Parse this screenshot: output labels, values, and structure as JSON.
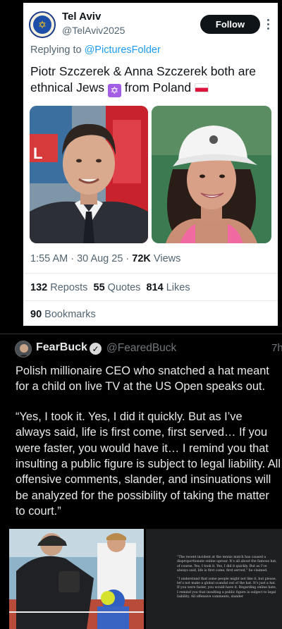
{
  "tweet1": {
    "avatar_icon": "menorah-logo-icon",
    "name": "Tel Aviv",
    "handle": "@TelAviv2025",
    "follow_label": "Follow",
    "reply_prefix": "Replying to",
    "reply_to": "@PicturesFolder",
    "text_before_star": "Piotr Szczerek & Anna Szczerek both are ethnical Jews ",
    "text_after_star": " from Poland ",
    "time": "1:55 AM · 30 Aug 25 · ",
    "views_count": "72K",
    "views_label": " Views",
    "reposts_count": "132",
    "reposts_label": " Reposts",
    "quotes_count": "55",
    "quotes_label": " Quotes",
    "likes_count": "814",
    "likes_label": " Likes",
    "bookmarks_count": "90",
    "bookmarks_label": " Bookmarks"
  },
  "tweet2": {
    "name": "FearBuck",
    "handle": "@FearedBuck",
    "time": "7h",
    "paragraph1": "Polish millionaire CEO who snatched a hat meant for a child on live TV at the US Open speaks out.",
    "paragraph2": "“Yes, I took it. Yes, I did it quickly. But as I’ve always said, life is first come, first served… If you were faster, you would have it… I remind you that insulting a public figure is subject to legal liability. All offensive comments, slander, and insinuations will be analyzed for the possibility of taking the matter to court.”",
    "article_p1": "“The recent incident at the tennis match has caused a disproportionate online uproar. It’s all about the famous hat, of course. Yes, I took it. Yes, I did it quickly. But as I’ve always said, life is first come, first served,” he claimed.",
    "article_p2": "“I understand that some people might not like it, but please, let’s not make a global scandal out of the hat. It’s just a hat. If you were faster, you would have it. Regarding online hate, I remind you that insulting a public figure is subject to legal liability. All offensive comments, slander"
  },
  "colors": {
    "link": "#1d9bf0",
    "dark_bg": "#000000",
    "dark_text": "#e7e9ea",
    "muted": "#71767b"
  }
}
